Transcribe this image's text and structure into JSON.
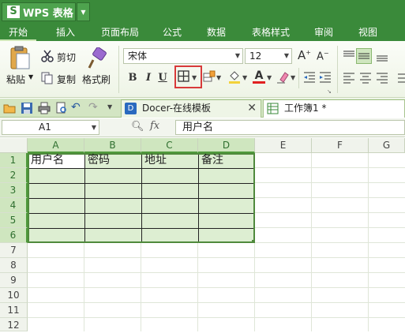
{
  "app": {
    "title": "WPS 表格",
    "logo": "S"
  },
  "menu": {
    "items": [
      "开始",
      "插入",
      "页面布局",
      "公式",
      "数据",
      "表格样式",
      "审阅",
      "视图"
    ],
    "active": "开始"
  },
  "ribbon": {
    "paste_label": "粘贴",
    "cut_label": "剪切",
    "copy_label": "复制",
    "format_painter_label": "格式刷",
    "font_name": "宋体",
    "font_size": "12",
    "bold": "B",
    "italic": "I",
    "underline": "U",
    "increase_font": "A",
    "decrease_font": "A",
    "font_color_letter": "A",
    "accent": "#3a8a3a",
    "highlight_color": "#d83a3a"
  },
  "tabs": [
    {
      "label": "Docer-在线模板",
      "icon": "docer-icon"
    },
    {
      "label": "工作簿1 *",
      "icon": "sheet-icon"
    }
  ],
  "formula_bar": {
    "cell_ref": "A1",
    "fx": "fx",
    "value": "用户名"
  },
  "grid": {
    "columns": [
      "A",
      "B",
      "C",
      "D",
      "E",
      "F",
      "G"
    ],
    "rows": [
      "1",
      "2",
      "3",
      "4",
      "5",
      "6",
      "7",
      "8",
      "9",
      "10",
      "11",
      "12"
    ],
    "header_row": [
      "用户名",
      "密码",
      "地址",
      "备注"
    ],
    "selected_range": "A1:D6"
  }
}
